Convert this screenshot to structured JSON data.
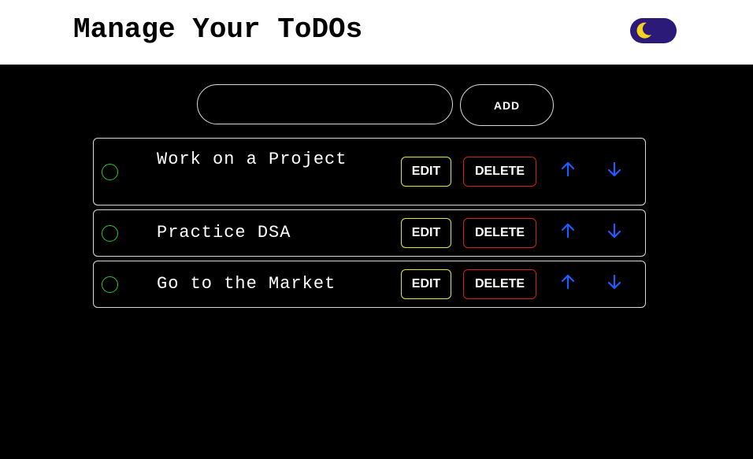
{
  "header": {
    "title": "Manage Your ToDOs",
    "theme_toggle_icon": "moon-icon",
    "toggle_bg": "#2b1a78",
    "moon_color": "#f4d21f"
  },
  "form": {
    "input_value": "",
    "add_label": "ADD"
  },
  "todos": [
    {
      "text": "Work on a Project",
      "edit_label": "EDIT",
      "delete_label": "DELETE",
      "completed": false
    },
    {
      "text": "Practice DSA",
      "edit_label": "EDIT",
      "delete_label": "DELETE",
      "completed": false
    },
    {
      "text": "Go to the Market",
      "edit_label": "EDIT",
      "delete_label": "DELETE",
      "completed": false
    }
  ],
  "colors": {
    "check": "#2fc62f",
    "edit_border": "#e6e635",
    "delete_border": "#d31f1f",
    "arrow": "#1f5bff"
  }
}
